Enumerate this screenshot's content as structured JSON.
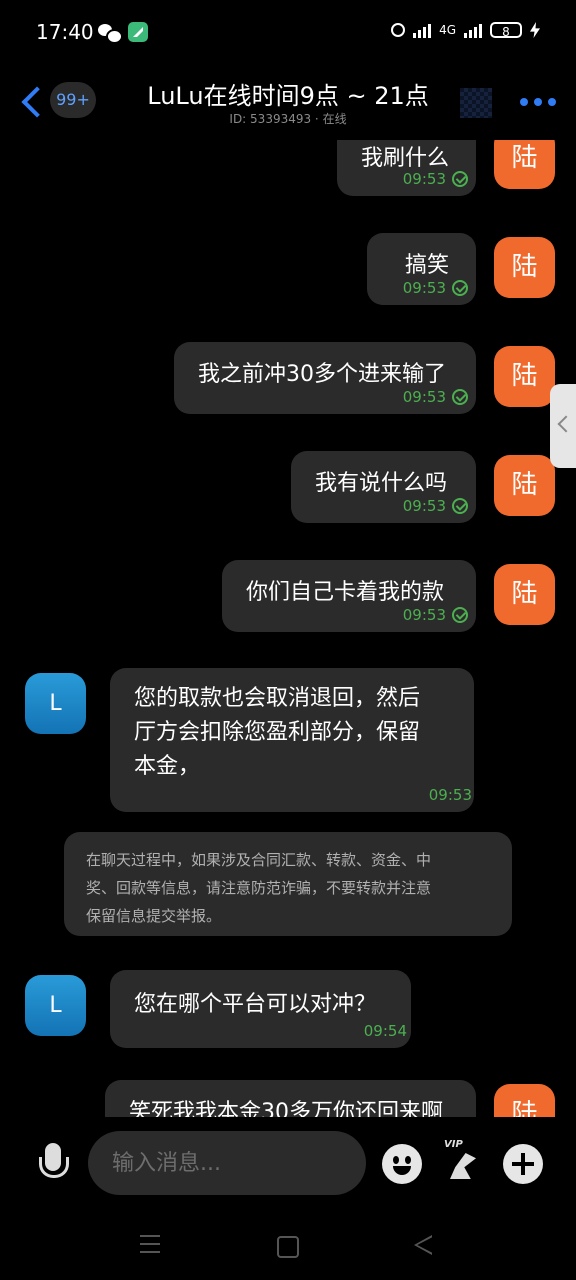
{
  "status_bar": {
    "time": "17:40",
    "network": "4G",
    "battery": "8"
  },
  "header": {
    "back_label": "back",
    "unread_badge": "99+",
    "title": "LuLu在线时间9点 ~ 21点",
    "subtitle": "ID: 53393493 · 在线"
  },
  "avatars": {
    "self": "陆",
    "other": "L"
  },
  "messages": [
    {
      "text": "我刷什么",
      "time": "09:53",
      "from": "self"
    },
    {
      "text": "搞笑",
      "time": "09:53",
      "from": "self"
    },
    {
      "text": "我之前冲30多个进来输了",
      "time": "09:53",
      "from": "self"
    },
    {
      "text": "我有说什么吗",
      "time": "09:53",
      "from": "self"
    },
    {
      "text": "你们自己卡着我的款",
      "time": "09:53",
      "from": "self"
    },
    {
      "lines": [
        "您的取款也会取消退回，然后",
        "厅方会扣除您盈利部分，保留",
        "本金，"
      ],
      "time": "09:53",
      "from": "other"
    },
    {
      "text": "您在哪个平台可以对冲？",
      "time": "09:54",
      "from": "other"
    },
    {
      "text": "笑死我我本金30多万你还回来啊",
      "time": "",
      "from": "self"
    }
  ],
  "notice": {
    "lines": [
      "在聊天过程中，如果涉及合同汇款、转款、资金、中",
      "奖、回款等信息，请注意防范诈骗，不要转款并注意",
      "保留信息提交举报。"
    ]
  },
  "input_bar": {
    "placeholder": "输入消息...",
    "vip_label": "VIP"
  },
  "colors": {
    "accent": "#2f7cf6",
    "self_avatar": "#f06a2d",
    "read_tick": "#4caf50",
    "bubble": "#2b2b2b"
  }
}
